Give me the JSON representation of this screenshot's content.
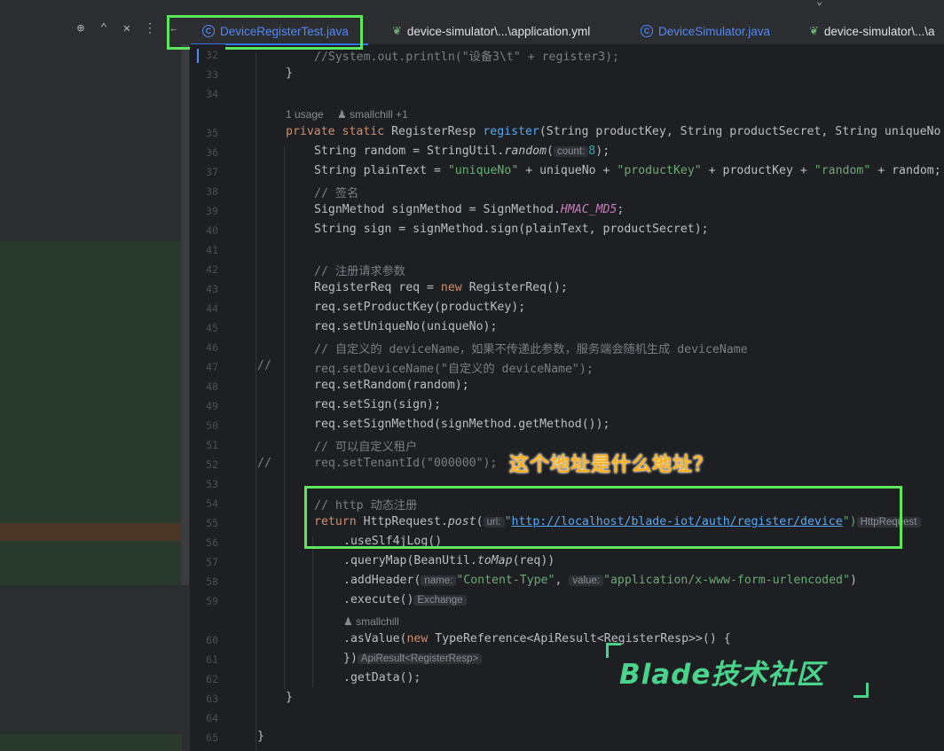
{
  "tabs": [
    {
      "label": "DeviceRegisterTest.java",
      "icon": "java-class-icon",
      "active": true
    },
    {
      "label": "device-simulator\\...\\application.yml",
      "icon": "yaml-icon",
      "active": false
    },
    {
      "label": "DeviceSimulator.java",
      "icon": "java-class-icon",
      "active": false
    },
    {
      "label": "device-simulator\\...\\a",
      "icon": "yaml-icon",
      "active": false
    }
  ],
  "left_panel_icons": [
    "target-icon",
    "expand-collapse-icon",
    "close-icon",
    "more-icon"
  ],
  "hints": {
    "usage": "1 usage",
    "author": "smallchill +1",
    "author2": "smallchill"
  },
  "inlays": {
    "count": "count:",
    "url": "url:",
    "name": "name:",
    "value": "value:",
    "http_request": "HttpRequest",
    "exchange": "Exchange",
    "api_result": "ApiResult<RegisterResp>"
  },
  "code": {
    "l32": "//System.out.println(\"设备3\\t\" + register3);",
    "l33": "}",
    "l35a": "private static ",
    "l35b": "RegisterResp ",
    "l35c": "register",
    "l35d": "(String productKey, String productSecret, String uniqueNo",
    "l36a": "String random = StringUtil.",
    "l36b": "random",
    "l36c": "(",
    "l36d": "8",
    "l36e": ");",
    "l37a": "String plainText = ",
    "l37b": "\"uniqueNo\"",
    "l37c": " + uniqueNo + ",
    "l37d": "\"productKey\"",
    "l37e": " + productKey + ",
    "l37f": "\"random\"",
    "l37g": " + random;",
    "l38": "// 签名",
    "l39a": "SignMethod signMethod = SignMethod.",
    "l39b": "HMAC_MD5",
    "l39c": ";",
    "l40": "String sign = signMethod.sign(plainText, productSecret);",
    "l42": "// 注册请求参数",
    "l43a": "RegisterReq req = ",
    "l43b": "new ",
    "l43c": "RegisterReq();",
    "l44": "req.setProductKey(productKey);",
    "l45": "req.setUniqueNo(uniqueNo);",
    "l46": "// 自定义的 deviceName，如果不传递此参数，服务端会随机生成 deviceName",
    "l47a": "//",
    "l47b": "req.setDeviceName(\"自定义的 deviceName\");",
    "l48": "req.setRandom(random);",
    "l49": "req.setSign(sign);",
    "l50": "req.setSignMethod(signMethod.getMethod());",
    "l51": "// 可以自定义租户",
    "l52a": "//",
    "l52b": "req.setTenantId(\"000000\");",
    "l54": "// http 动态注册",
    "l55a": "return ",
    "l55b": "HttpRequest.",
    "l55c": "post",
    "l55d": "(",
    "l55e": "\"",
    "l55f": "http://localhost/blade-iot/auth/register/device",
    "l55g": "\")",
    "l56": ".useSlf4jLog()",
    "l57a": ".queryMap(BeanUtil.",
    "l57b": "toMap",
    "l57c": "(req))",
    "l58a": ".addHeader(",
    "l58b": "\"Content-Type\"",
    "l58c": ", ",
    "l58d": "\"application/x-www-form-urlencoded\"",
    "l58e": ")",
    "l59": ".execute()",
    "l60a": ".asValue(",
    "l60b": "new ",
    "l60c": "TypeReference<ApiResult<RegisterResp>>() {",
    "l61": "})",
    "l62": ".getData();",
    "l63": "}",
    "l65": "}"
  },
  "line_numbers": [
    "32",
    "33",
    "34",
    "35",
    "36",
    "37",
    "38",
    "39",
    "40",
    "41",
    "42",
    "43",
    "44",
    "45",
    "46",
    "47",
    "48",
    "49",
    "50",
    "51",
    "52",
    "53",
    "54",
    "55",
    "56",
    "57",
    "58",
    "59",
    "60",
    "61",
    "62",
    "63",
    "64",
    "65"
  ],
  "annotation": "这个地址是什么地址？",
  "watermark": "Blade技术社区",
  "colors": {
    "highlight_box": "#5ee65c",
    "annotation": "#ffb21e",
    "watermark": "#4ad38a",
    "keyword": "#cf8e6d",
    "string": "#6aab73"
  }
}
